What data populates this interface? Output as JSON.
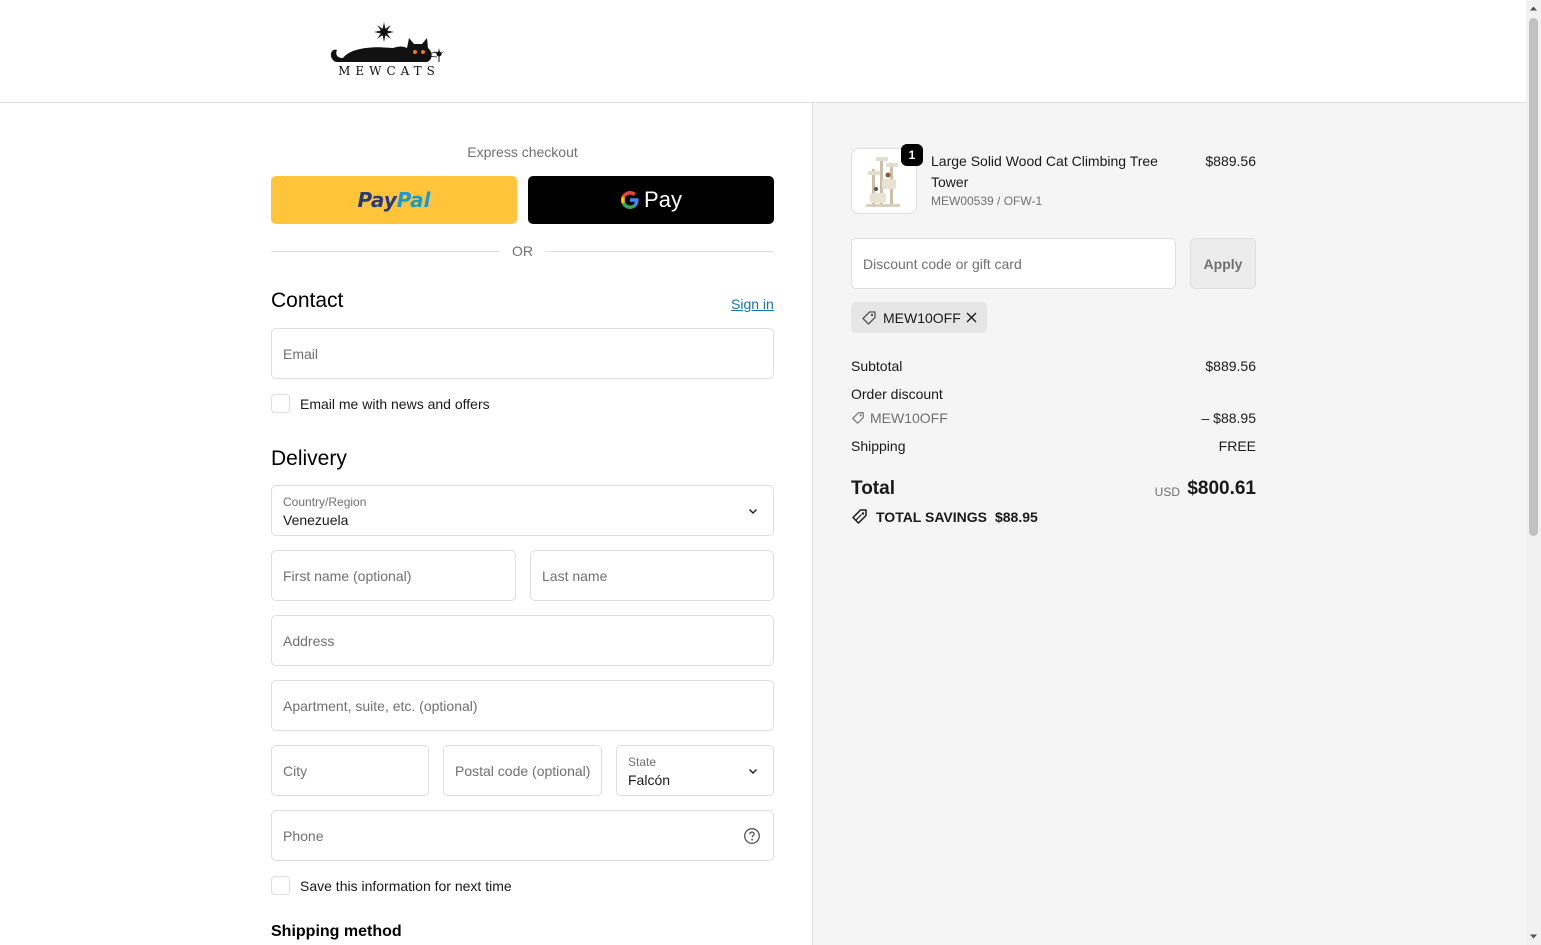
{
  "brand": {
    "logo_text": "MEWCATS"
  },
  "express": {
    "label": "Express checkout",
    "paypal_label_1": "Pay",
    "paypal_label_2": "Pal",
    "gpay_label": "Pay",
    "or_text": "OR"
  },
  "contact": {
    "title": "Contact",
    "sign_in": "Sign in",
    "email_placeholder": "Email",
    "newsletter_label": "Email me with news and offers"
  },
  "delivery": {
    "title": "Delivery",
    "country_label": "Country/Region",
    "country_value": "Venezuela",
    "first_name_placeholder": "First name (optional)",
    "last_name_placeholder": "Last name",
    "address_placeholder": "Address",
    "apartment_placeholder": "Apartment, suite, etc. (optional)",
    "city_placeholder": "City",
    "postal_placeholder": "Postal code (optional)",
    "state_label": "State",
    "state_value": "Falcón",
    "phone_placeholder": "Phone",
    "save_info_label": "Save this information for next time"
  },
  "shipping_method": {
    "title": "Shipping method"
  },
  "order": {
    "product": {
      "name": "Large Solid Wood Cat Climbing Tree Tower",
      "variant": "MEW00539 / OFW-1",
      "price": "$889.56",
      "quantity": "1"
    },
    "discount_placeholder": "Discount code or gift card",
    "apply_label": "Apply",
    "applied_code": "MEW10OFF",
    "subtotal_label": "Subtotal",
    "subtotal_value": "$889.56",
    "order_discount_label": "Order discount",
    "discount_code": "MEW10OFF",
    "discount_value": "– $88.95",
    "shipping_label": "Shipping",
    "shipping_value": "FREE",
    "total_label": "Total",
    "currency": "USD",
    "total_value": "$800.61",
    "savings_label": "TOTAL SAVINGS",
    "savings_value": "$88.95"
  },
  "colors": {
    "paypal_yellow": "#ffc439",
    "paypal_dark_blue": "#253b80",
    "paypal_light_blue": "#179bd7",
    "link_blue": "#1773b0",
    "summary_bg": "#f5f5f5"
  }
}
